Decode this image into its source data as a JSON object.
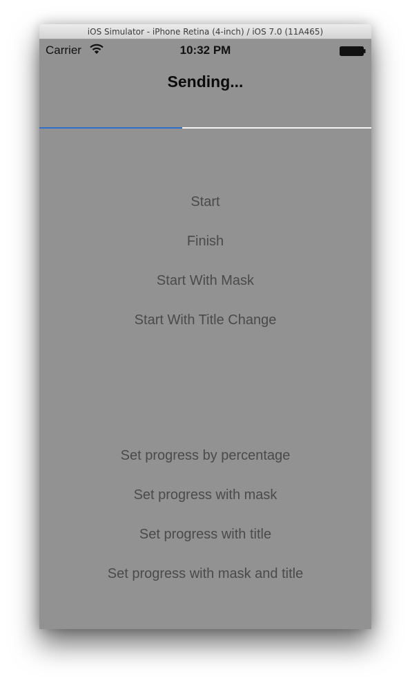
{
  "window": {
    "title": "iOS Simulator - iPhone Retina (4-inch) / iOS 7.0 (11A465)"
  },
  "status_bar": {
    "carrier": "Carrier",
    "time": "10:32 PM",
    "wifi_icon": "wifi-icon",
    "battery_icon": "battery-icon"
  },
  "nav_bar": {
    "title": "Sending...",
    "progress": 0.43,
    "progress_color": "#2f6fc7",
    "track_color": "#f4f4f4"
  },
  "colors": {
    "screen_background": "#929292",
    "button_text": "#4a4a4a"
  },
  "buttons": {
    "start": "Start",
    "finish": "Finish",
    "start_with_mask": "Start With Mask",
    "start_with_title_change": "Start With Title Change",
    "set_progress_by_percentage": "Set progress by percentage",
    "set_progress_with_mask": "Set progress with mask",
    "set_progress_with_title": "Set progress with title",
    "set_progress_with_mask_and_title": "Set progress with mask and title"
  }
}
